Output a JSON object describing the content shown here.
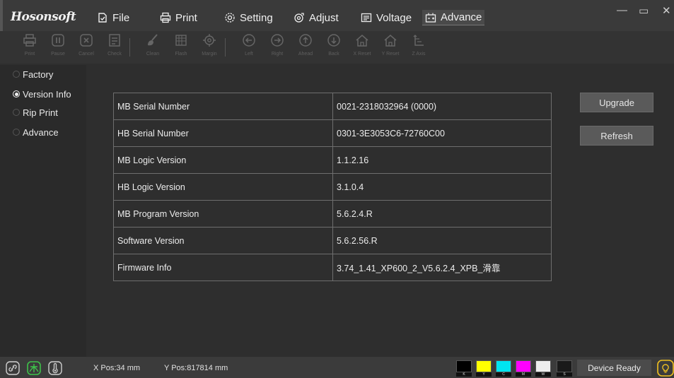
{
  "app": {
    "brand": "Hosonsoft"
  },
  "menu": {
    "file": "File",
    "print": "Print",
    "setting": "Setting",
    "adjust": "Adjust",
    "voltage": "Voltage",
    "advance": "Advance"
  },
  "window": {
    "minimize": "—",
    "maximize": "▭",
    "close": "✕"
  },
  "toolbar": {
    "print": "Print",
    "pause": "Pause",
    "cancel": "Cancel",
    "check": "Check",
    "clean": "Clean",
    "flash": "Flash",
    "margin": "Margin",
    "left": "Left",
    "right": "Right",
    "ahead": "Ahead",
    "back": "Back",
    "x_reset": "X Reset",
    "y_reset": "Y Reset",
    "z_axis": "Z Axis"
  },
  "sidebar": {
    "items": [
      {
        "label": "Factory",
        "selected": false
      },
      {
        "label": "Version Info",
        "selected": true
      },
      {
        "label": "Rip Print",
        "selected": false
      },
      {
        "label": "Advance",
        "selected": false
      }
    ]
  },
  "info": {
    "rows": [
      {
        "key": "MB Serial Number",
        "value": "0021-2318032964  (0000)"
      },
      {
        "key": "HB Serial Number",
        "value": "0301-3E3053C6-72760C00"
      },
      {
        "key": "MB Logic Version",
        "value": "1.1.2.16"
      },
      {
        "key": "HB Logic Version",
        "value": "3.1.0.4"
      },
      {
        "key": "MB Program Version",
        "value": "5.6.2.4.R"
      },
      {
        "key": "Software Version",
        "value": "5.6.2.56.R"
      },
      {
        "key": "Firmware Info",
        "value": "3.74_1.41_XP600_2_V5.6.2.4_XPB_滑靠"
      }
    ]
  },
  "buttons": {
    "upgrade": "Upgrade",
    "refresh": "Refresh"
  },
  "status": {
    "xpos": "X Pos:34 mm",
    "ypos": "Y Pos:817814 mm",
    "device_state": "Device Ready",
    "inks": [
      {
        "label": "K",
        "color": "#000000"
      },
      {
        "label": "Y",
        "color": "#ffff00"
      },
      {
        "label": "C",
        "color": "#00e5f0"
      },
      {
        "label": "M",
        "color": "#ff00ff"
      },
      {
        "label": "W",
        "color": "#eeeeee"
      },
      {
        "label": "S",
        "color": "#1a1a1a"
      }
    ]
  },
  "colors": {
    "background": "#2e2e2e",
    "menubar": "#3a3a3a",
    "button": "#5a5a5a",
    "bulb": "#f0c020"
  }
}
